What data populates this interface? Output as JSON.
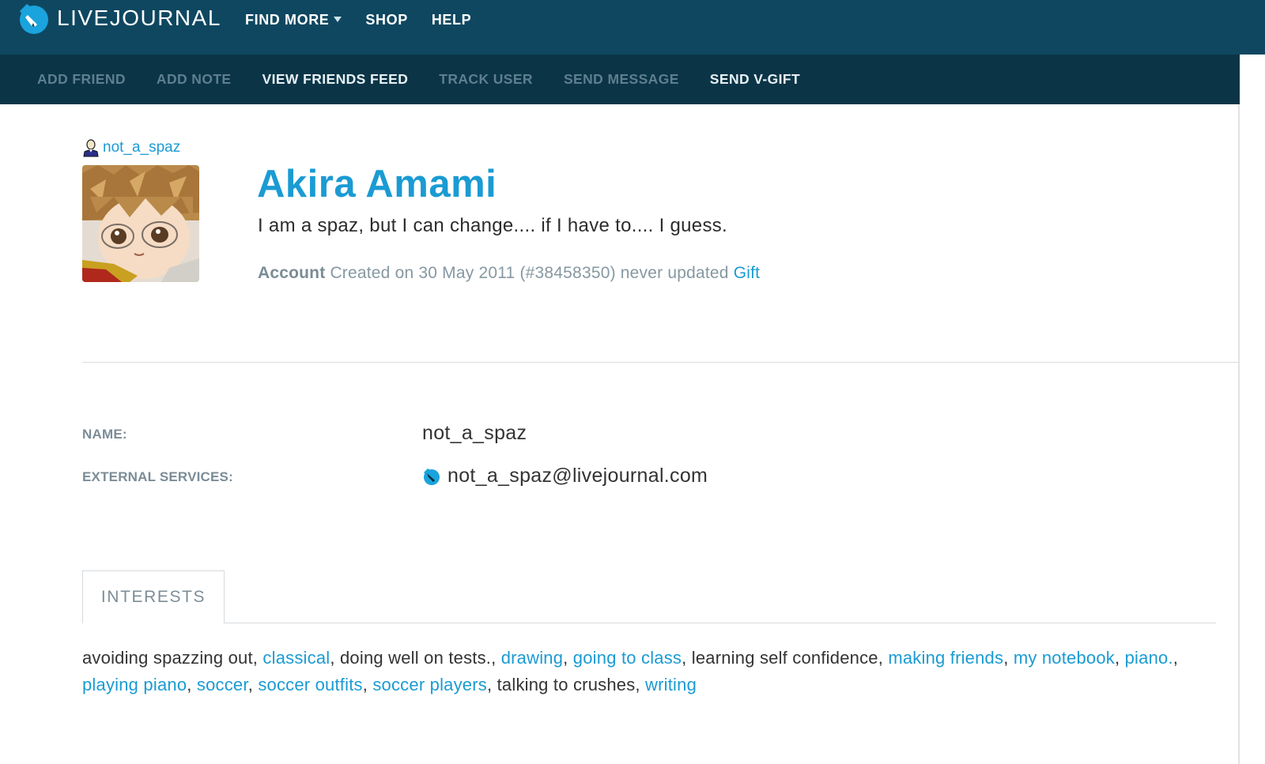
{
  "header": {
    "logo_text": "LIVEJOURNAL",
    "nav": [
      {
        "label": "FIND MORE",
        "has_dropdown": true
      },
      {
        "label": "SHOP"
      },
      {
        "label": "HELP"
      }
    ]
  },
  "subnav": {
    "items": [
      {
        "label": "ADD FRIEND",
        "enabled": false
      },
      {
        "label": "ADD NOTE",
        "enabled": false
      },
      {
        "label": "VIEW FRIENDS FEED",
        "enabled": true
      },
      {
        "label": "TRACK USER",
        "enabled": false
      },
      {
        "label": "SEND MESSAGE",
        "enabled": false
      },
      {
        "label": "SEND V-GIFT",
        "enabled": true
      }
    ]
  },
  "profile": {
    "username": "not_a_spaz",
    "full_name": "Akira Amami",
    "tagline": "I am a spaz, but I can change.... if I have to.... I guess.",
    "account": {
      "label": "Account",
      "info": " Created on 30 May 2011 (#38458350) never updated ",
      "gift_link": "Gift"
    }
  },
  "details": {
    "name_label": "NAME:",
    "name_value": "not_a_spaz",
    "external_label": "EXTERNAL SERVICES:",
    "external_value": "not_a_spaz@livejournal.com"
  },
  "interests_tab": {
    "label": "INTERESTS",
    "items": [
      {
        "text": "avoiding spazzing out",
        "link": false
      },
      {
        "text": "classical",
        "link": true
      },
      {
        "text": "doing well on tests.",
        "link": false
      },
      {
        "text": "drawing",
        "link": true
      },
      {
        "text": "going to class",
        "link": true
      },
      {
        "text": "learning self confidence",
        "link": false
      },
      {
        "text": "making friends",
        "link": true
      },
      {
        "text": "my notebook",
        "link": true
      },
      {
        "text": "piano.",
        "link": true
      },
      {
        "text": "playing piano",
        "link": true
      },
      {
        "text": "soccer",
        "link": true
      },
      {
        "text": "soccer outfits",
        "link": true
      },
      {
        "text": "soccer players",
        "link": true
      },
      {
        "text": "talking to crushes",
        "link": false
      },
      {
        "text": "writing",
        "link": true
      }
    ]
  },
  "colors": {
    "header_bg": "#0f4760",
    "subnav_bg": "#0b3547",
    "link": "#1a9bd3"
  }
}
